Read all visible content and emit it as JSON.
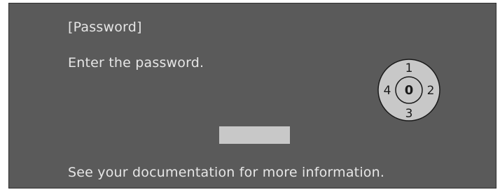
{
  "dialog": {
    "title": "[Password]",
    "prompt": "Enter the password.",
    "footer": "See your documentation for more information.",
    "password_value": ""
  },
  "keypad": {
    "top": "1",
    "right": "2",
    "bottom": "3",
    "left": "4",
    "center": "0"
  },
  "colors": {
    "background": "#5a5a5a",
    "text": "#e6e6e6",
    "field": "#c8c8c8",
    "dial": "#c8c8c8"
  }
}
